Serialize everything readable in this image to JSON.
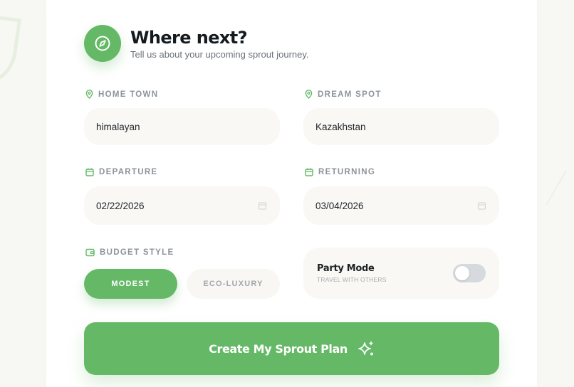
{
  "header": {
    "title": "Where next?",
    "subtitle": "Tell us about your upcoming sprout journey.",
    "icon": "compass-icon"
  },
  "fields": {
    "home_town": {
      "label": "HOME TOWN",
      "value": "himalayan",
      "icon": "map-pin-icon"
    },
    "dream_spot": {
      "label": "DREAM SPOT",
      "value": "Kazakhstan",
      "icon": "map-pin-icon"
    },
    "departure": {
      "label": "DEPARTURE",
      "value": "02/22/2026",
      "icon": "calendar-icon"
    },
    "returning": {
      "label": "RETURNING",
      "value": "03/04/2026",
      "icon": "calendar-icon"
    }
  },
  "budget": {
    "label": "BUDGET STYLE",
    "icon": "wallet-icon",
    "options": [
      "MODEST",
      "ECO-LUXURY"
    ],
    "selected": "MODEST"
  },
  "party_mode": {
    "title": "Party Mode",
    "subtitle": "TRAVEL WITH OTHERS",
    "enabled": false
  },
  "cta": {
    "label": "Create My Sprout Plan",
    "icon": "sparkles-icon"
  },
  "colors": {
    "accent": "#64b866",
    "field_bg": "#f9f8f4",
    "text_dark": "#151a1f",
    "label_gray": "#8e939a"
  }
}
